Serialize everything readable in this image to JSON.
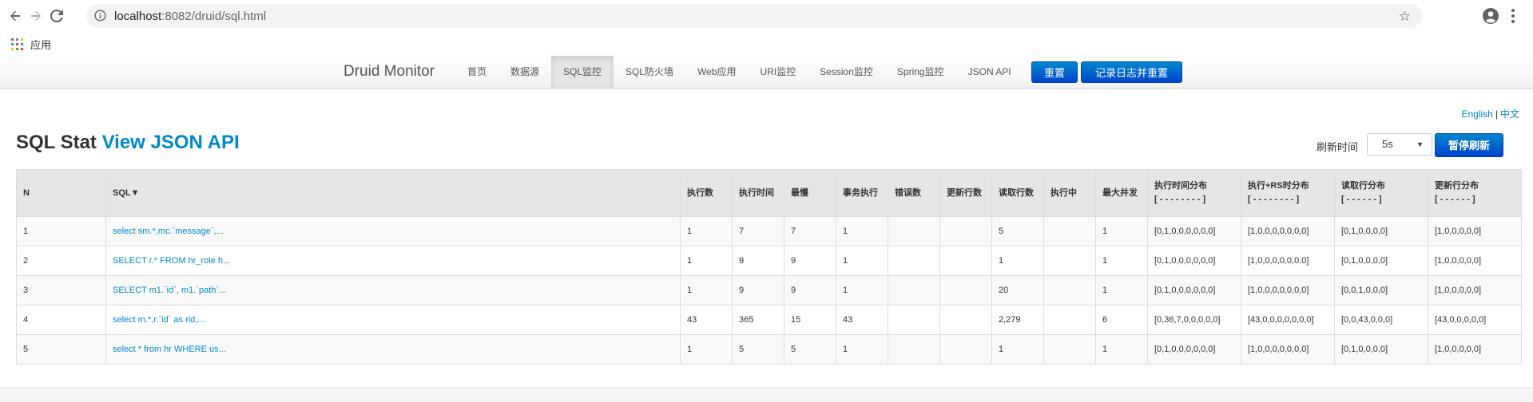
{
  "browser": {
    "url_host": "localhost",
    "url_rest": ":8082/druid/sql.html",
    "bookmark_apps": "应用"
  },
  "navbar": {
    "brand": "Druid Monitor",
    "links": [
      "首页",
      "数据源",
      "SQL监控",
      "SQL防火墙",
      "Web应用",
      "URI监控",
      "Session监控",
      "Spring监控",
      "JSON API"
    ],
    "active_index": 2,
    "reset_button": "重置",
    "log_reset_button": "记录日志并重置"
  },
  "lang": {
    "english": "English",
    "separator": "|",
    "chinese": "中文"
  },
  "header": {
    "title": "SQL Stat",
    "title_link": "View JSON API",
    "refresh_label": "刷新时间",
    "refresh_value": "5s",
    "pause_button": "暂停刷新"
  },
  "table": {
    "columns": [
      "N",
      "SQL▼",
      "执行数",
      "执行时间",
      "最慢",
      "事务执行",
      "错误数",
      "更新行数",
      "读取行数",
      "执行中",
      "最大并发",
      "执行时间分布",
      "执行+RS时分布",
      "读取行分布",
      "更新行分布"
    ],
    "column_sublabels": [
      "",
      "",
      "",
      "",
      "",
      "",
      "",
      "",
      "",
      "",
      "",
      "[ - - - - - - - - ]",
      "[ - - - - - - - - ]",
      "[ - - - - - - ]",
      "[ - - - - - - ]"
    ],
    "rows": [
      [
        "1",
        "select sm.*,mc.`message`,...",
        "1",
        "7",
        "7",
        "1",
        "",
        "",
        "5",
        "",
        "1",
        "[0,1,0,0,0,0,0,0]",
        "[1,0,0,0,0,0,0,0]",
        "[0,1,0,0,0,0]",
        "[1,0,0,0,0,0]"
      ],
      [
        "2",
        "SELECT r.* FROM hr_role h...",
        "1",
        "9",
        "9",
        "1",
        "",
        "",
        "1",
        "",
        "1",
        "[0,1,0,0,0,0,0,0]",
        "[1,0,0,0,0,0,0,0]",
        "[0,1,0,0,0,0]",
        "[1,0,0,0,0,0]"
      ],
      [
        "3",
        "SELECT m1.`id`, m1.`path`...",
        "1",
        "9",
        "9",
        "1",
        "",
        "",
        "20",
        "",
        "1",
        "[0,1,0,0,0,0,0,0]",
        "[1,0,0,0,0,0,0,0]",
        "[0,0,1,0,0,0]",
        "[1,0,0,0,0,0]"
      ],
      [
        "4",
        "select m.*,r.`id` as rid,...",
        "43",
        "365",
        "15",
        "43",
        "",
        "",
        "2,279",
        "",
        "6",
        "[0,36,7,0,0,0,0,0]",
        "[43,0,0,0,0,0,0,0]",
        "[0,0,43,0,0,0]",
        "[43,0,0,0,0,0]"
      ],
      [
        "5",
        "select * from hr WHERE us...",
        "1",
        "5",
        "5",
        "1",
        "",
        "",
        "1",
        "",
        "1",
        "[0,1,0,0,0,0,0,0]",
        "[1,0,0,0,0,0,0,0]",
        "[0,1,0,0,0,0]",
        "[1,0,0,0,0,0]"
      ]
    ]
  }
}
